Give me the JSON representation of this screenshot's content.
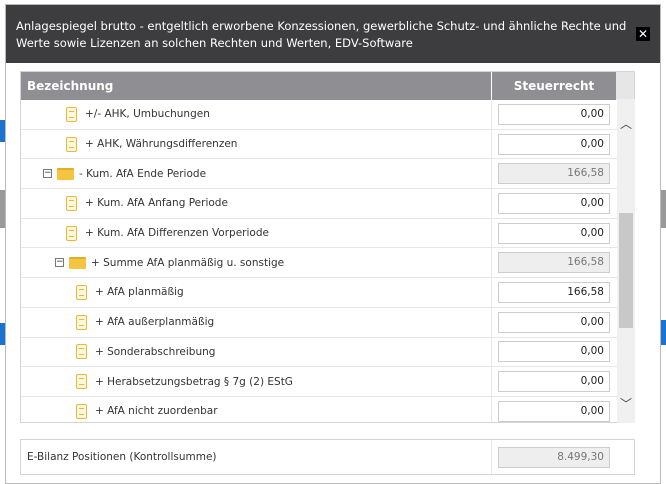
{
  "dialog": {
    "title": "Anlagespiegel brutto - entgeltlich erworbene Konzessionen, gewerbliche Schutz- und ähnliche Rechte und Werte sowie Lizenzen an solchen Rechten und Werten, EDV-Software",
    "close_label": "✕"
  },
  "columns": {
    "name": "Bezeichnung",
    "value": "Steuerrecht"
  },
  "rows": [
    {
      "label": "+/- AHK, Umbuchungen",
      "value": "0,00"
    },
    {
      "label": "+ AHK, Währungsdifferenzen",
      "value": "0,00"
    },
    {
      "label": "- Kum. AfA Ende Periode",
      "value": "166,58"
    },
    {
      "label": "+ Kum. AfA Anfang Periode",
      "value": "0,00"
    },
    {
      "label": "+ Kum. AfA Differenzen Vorperiode",
      "value": "0,00"
    },
    {
      "label": "+ Summe AfA planmäßig u. sonstige",
      "value": "166,58"
    },
    {
      "label": "+ AfA planmäßig",
      "value": "166,58"
    },
    {
      "label": "+ AfA außerplanmäßig",
      "value": "0,00"
    },
    {
      "label": "+ Sonderabschreibung",
      "value": "0,00"
    },
    {
      "label": "+ Herabsetzungsbetrag § 7g (2) EStG",
      "value": "0,00"
    },
    {
      "label": "+ AfA nicht zuordenbar",
      "value": "0,00"
    }
  ],
  "summary": {
    "label": "E-Bilanz Positionen (Kontrollsumme)",
    "value": "8.499,30"
  },
  "toggle_symbol": "−"
}
